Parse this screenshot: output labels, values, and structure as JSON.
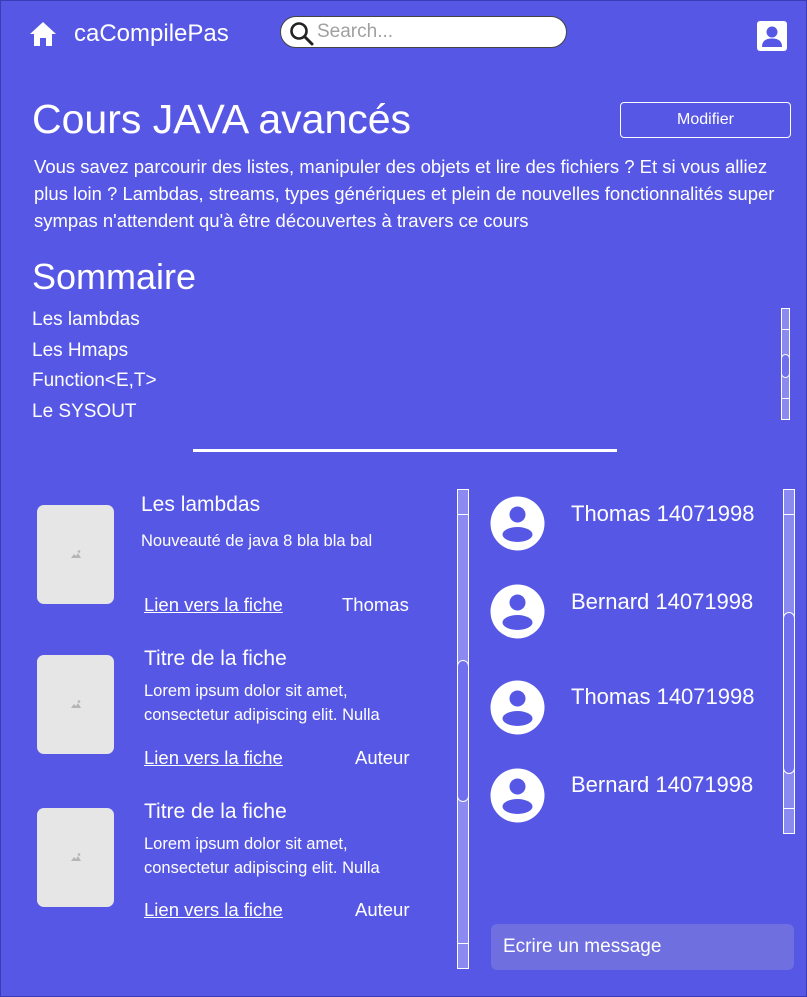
{
  "header": {
    "brand": "caCompilePas",
    "search_placeholder": "Search..."
  },
  "course": {
    "title": "Cours JAVA avancés",
    "edit_label": "Modifier",
    "description": "Vous savez parcourir des listes, manipuler des objets et lire des fichiers ? Et si vous alliez plus loin ? Lambdas, streams, types génériques et plein de nouvelles fonctionnalités super sympas n'attendent qu'à être découvertes à travers ce cours"
  },
  "toc": {
    "title": "Sommaire",
    "items": [
      "Les lambdas",
      "Les Hmaps",
      "Function<E,T>",
      "Le SYSOUT"
    ]
  },
  "cards": [
    {
      "title": "Les lambdas",
      "description": "Nouveauté de java 8 bla bla bal",
      "link": "Lien vers la fiche",
      "author": "Thomas"
    },
    {
      "title": "Titre de la fiche",
      "description": "Lorem ipsum dolor sit amet, consectetur adipiscing elit. Nulla",
      "link": "Lien vers la fiche",
      "author": "Auteur"
    },
    {
      "title": "Titre de la fiche",
      "description": "Lorem ipsum dolor sit amet, consectetur adipiscing elit. Nulla",
      "link": "Lien vers la fiche",
      "author": "Auteur"
    }
  ],
  "chat": {
    "messages": [
      {
        "text": "Thomas 14071998"
      },
      {
        "text": "Bernard 14071998"
      },
      {
        "text": "Thomas 14071998"
      },
      {
        "text": "Bernard 14071998"
      }
    ],
    "input_placeholder": "Ecrire un message"
  },
  "colors": {
    "background": "#5757e6",
    "text": "#ffffff",
    "thumbnail": "#e6e6e6"
  }
}
